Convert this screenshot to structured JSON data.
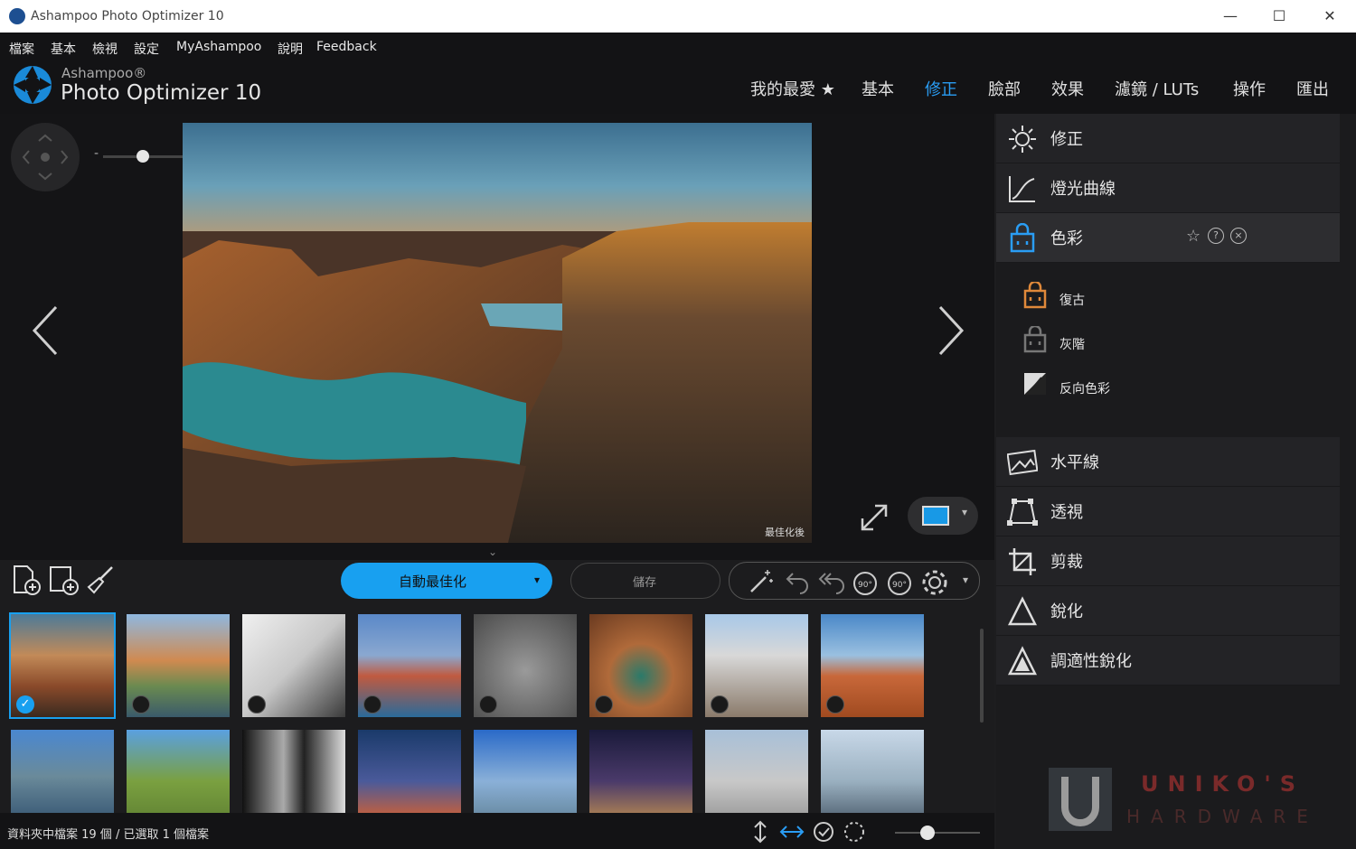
{
  "window": {
    "title": "Ashampoo Photo Optimizer 10"
  },
  "menu": [
    "檔案",
    "基本",
    "檢視",
    "設定",
    "MyAshampoo",
    "說明",
    "Feedback"
  ],
  "brand": {
    "small": "Ashampoo®",
    "big": "Photo Optimizer 10"
  },
  "category_tabs": [
    {
      "label": "我的最愛 ★",
      "active": false
    },
    {
      "label": "基本",
      "active": false
    },
    {
      "label": "修正",
      "active": true
    },
    {
      "label": "臉部",
      "active": false
    },
    {
      "label": "效果",
      "active": false
    },
    {
      "label": "濾鏡 / LUTs",
      "active": false
    },
    {
      "label": "操作",
      "active": false
    },
    {
      "label": "匯出",
      "active": false
    }
  ],
  "viewer": {
    "photo_caption": "最佳化後",
    "zoom_minus": "-",
    "zoom_plus": "+"
  },
  "right_panel": {
    "correction": "修正",
    "light_curve": "燈光曲線",
    "color": "色彩",
    "color_subtools": [
      "復古",
      "灰階",
      "反向色彩"
    ],
    "tools": [
      "水平線",
      "透視",
      "剪裁",
      "銳化",
      "調適性銳化"
    ]
  },
  "toolbar": {
    "auto_optimize": "自動最佳化",
    "save": "儲存"
  },
  "status": {
    "text": "資料夾中檔案 19 個 / 已選取 1 個檔案"
  },
  "watermark": {
    "line1": "UNIKO'S",
    "line2": "HARDWARE"
  },
  "colors": {
    "accent": "#18a0f0",
    "active_tab": "#2a9df4",
    "panel_bg": "#232326"
  }
}
